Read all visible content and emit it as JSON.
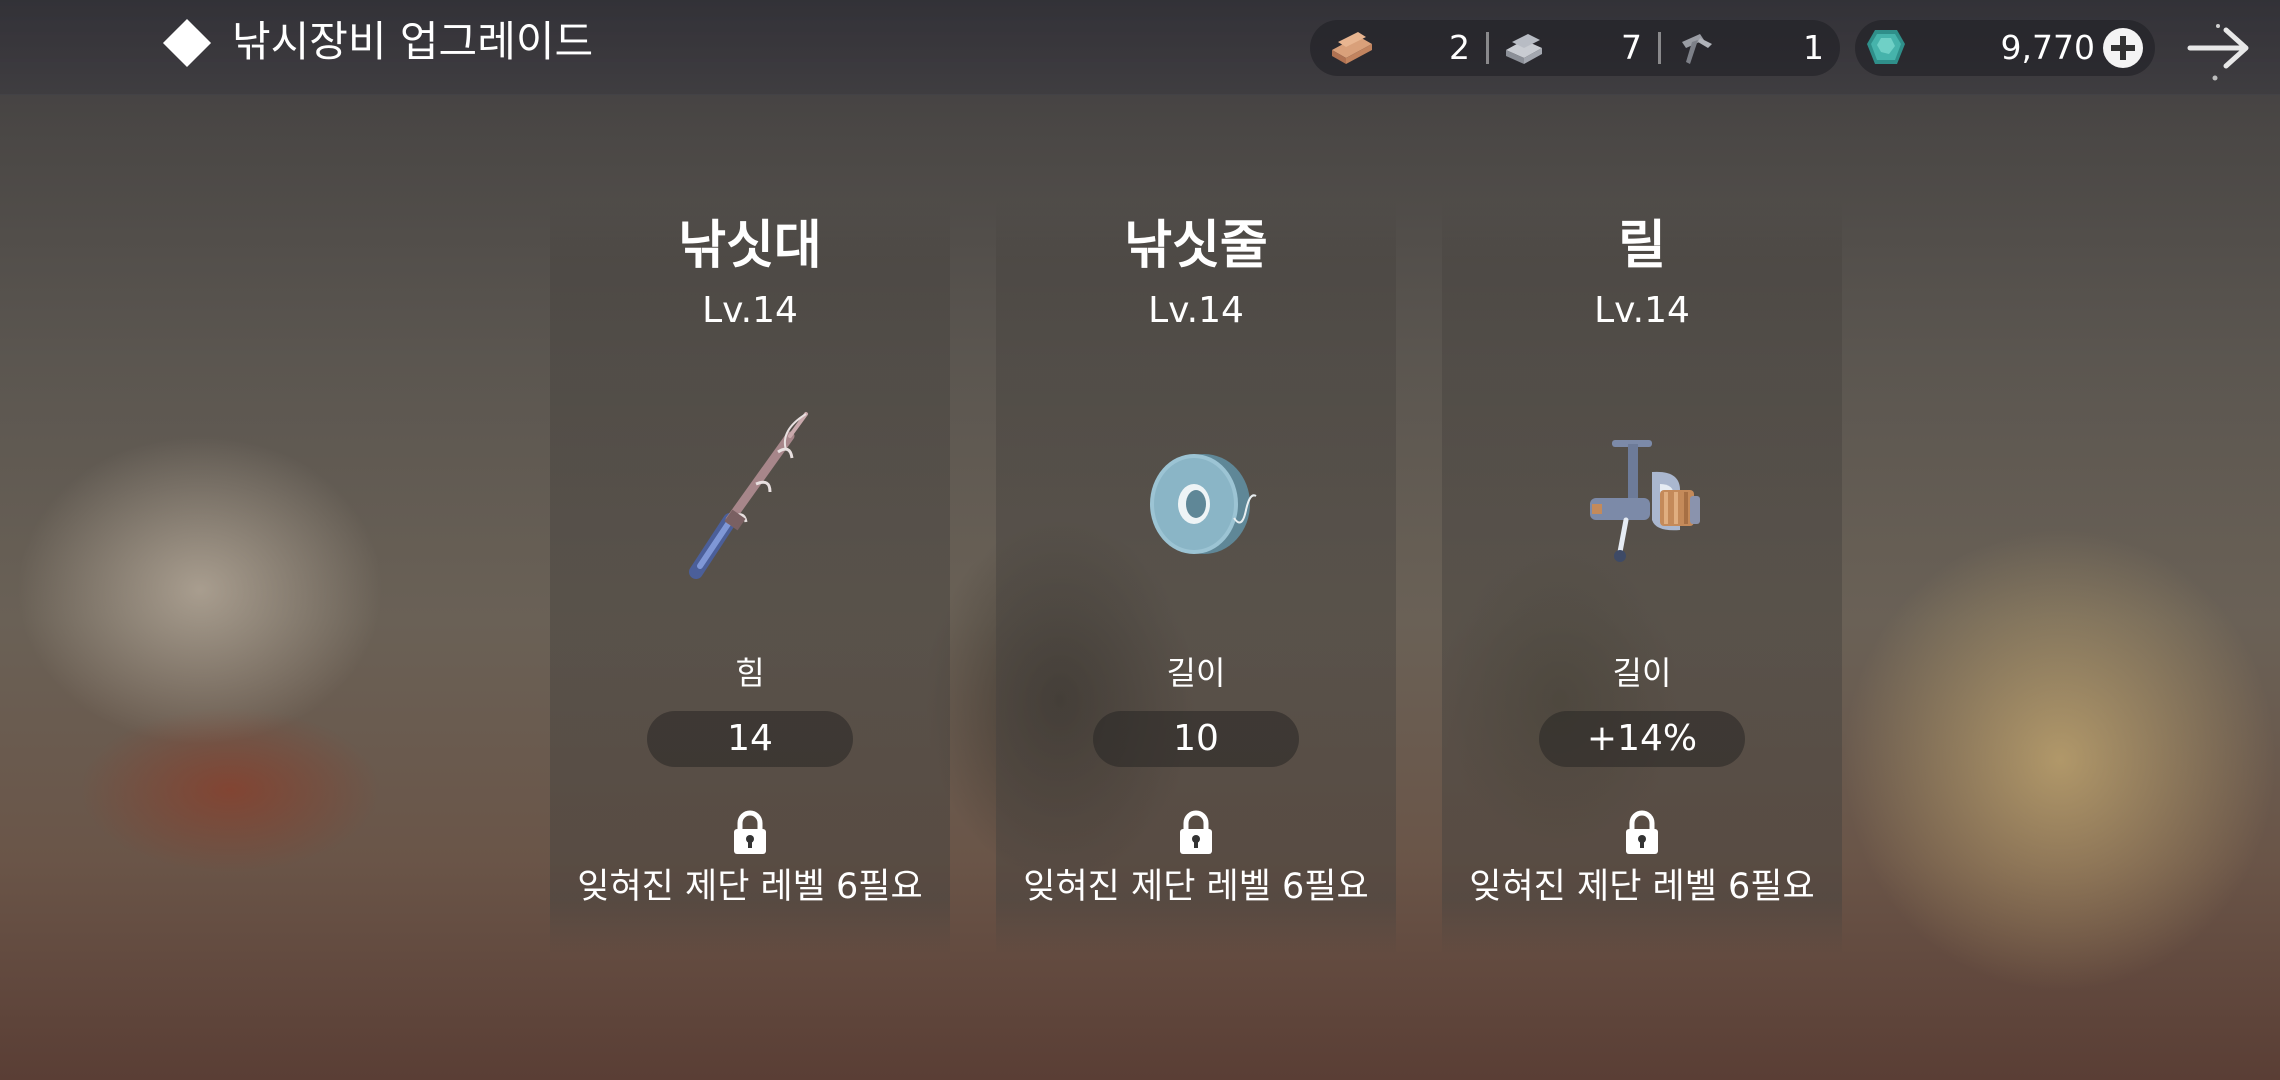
{
  "header": {
    "title": "낚시장비 업그레이드"
  },
  "resources": {
    "items": [
      {
        "icon": "wood-plank-icon",
        "value": "2"
      },
      {
        "icon": "iron-ingot-icon",
        "value": "7"
      },
      {
        "icon": "nail-icon",
        "value": "1"
      }
    ],
    "gem": {
      "icon": "gem-icon",
      "value": "9,770"
    }
  },
  "cards": [
    {
      "name": "낚싯대",
      "level": "Lv.14",
      "icon": "fishing-rod-icon",
      "stat_label": "힘",
      "stat_value": "14",
      "lock_text": "잊혀진 제단 레벨 6필요"
    },
    {
      "name": "낚싯줄",
      "level": "Lv.14",
      "icon": "fishing-line-spool-icon",
      "stat_label": "길이",
      "stat_value": "10",
      "lock_text": "잊혀진 제단 레벨 6필요"
    },
    {
      "name": "릴",
      "level": "Lv.14",
      "icon": "fishing-reel-icon",
      "stat_label": "길이",
      "stat_value": "+14%",
      "lock_text": "잊혀진 제단 레벨 6필요"
    }
  ],
  "colors": {
    "text": "#ffffff",
    "gem": "#3fa7a0",
    "rod_blue": "#6f86c4",
    "spool": "#8fb9c9",
    "reel_copper": "#c48a5a"
  }
}
